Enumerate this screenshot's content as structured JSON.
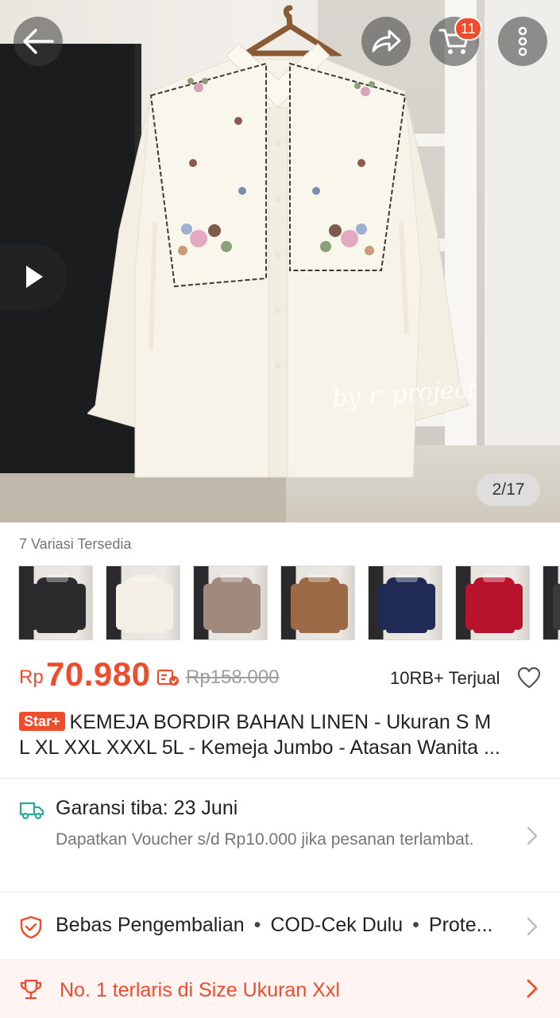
{
  "header": {
    "cart_count": "11"
  },
  "hero": {
    "watermark": "by r_project",
    "image_counter": "2/17"
  },
  "variants": {
    "label": "7 Variasi Tersedia",
    "colors": [
      "#2b2b2d",
      "#f3efe4",
      "#a08a7d",
      "#9c6a45",
      "#1f2a55",
      "#b8122c",
      "#3a3a3a"
    ]
  },
  "price": {
    "currency": "Rp",
    "value": "70.980",
    "original": "Rp158.000",
    "sold": "10RB+ Terjual"
  },
  "title": {
    "badge": "Star+",
    "line1": "KEMEJA BORDIR BAHAN LINEN - Ukuran S M",
    "line2": "L XL XXL XXXL 5L - Kemeja Jumbo - Atasan Wanita ..."
  },
  "shipping": {
    "title": "Garansi tiba: 23 Juni",
    "desc": "Dapatkan Voucher s/d Rp10.000 jika pesanan terlambat."
  },
  "features": {
    "items": [
      "Bebas Pengembalian",
      "COD-Cek Dulu",
      "Prote..."
    ]
  },
  "best_seller": {
    "text": "No. 1 terlaris di Size Ukuran Xxl"
  },
  "colors": {
    "accent": "#ee4d2d",
    "ship_icon": "#26aa99"
  }
}
